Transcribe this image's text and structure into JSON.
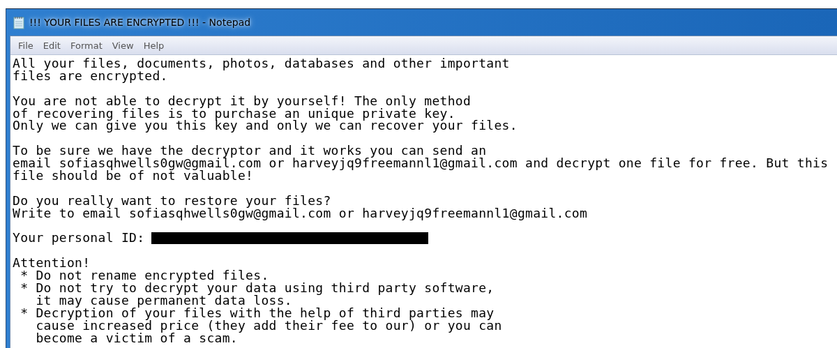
{
  "window": {
    "title": "!!! YOUR FILES ARE ENCRYPTED !!! - Notepad"
  },
  "menu": [
    "File",
    "Edit",
    "Format",
    "View",
    "Help"
  ],
  "lines": [
    {
      "kind": "text",
      "text": "All your files, documents, photos, databases and other important"
    },
    {
      "kind": "text",
      "text": "files are encrypted."
    },
    {
      "kind": "blank"
    },
    {
      "kind": "text",
      "text": "You are not able to decrypt it by yourself! The only method"
    },
    {
      "kind": "text",
      "text": "of recovering files is to purchase an unique private key."
    },
    {
      "kind": "text",
      "text": "Only we can give you this key and only we can recover your files."
    },
    {
      "kind": "blank"
    },
    {
      "kind": "text",
      "text": "To be sure we have the decryptor and it works you can send an"
    },
    {
      "kind": "text",
      "text": "email sofiasqhwells0gw@gmail.com or harveyjq9freemannl1@gmail.com and decrypt one file for free. But this"
    },
    {
      "kind": "text",
      "text": "file should be of not valuable!"
    },
    {
      "kind": "blank"
    },
    {
      "kind": "text",
      "text": "Do you really want to restore your files?"
    },
    {
      "kind": "text",
      "text": "Write to email sofiasqhwells0gw@gmail.com or harveyjq9freemannl1@gmail.com"
    },
    {
      "kind": "blank"
    },
    {
      "kind": "redacted",
      "text": "Your personal ID:"
    },
    {
      "kind": "blank"
    },
    {
      "kind": "text",
      "text": "Attention!"
    },
    {
      "kind": "text",
      "text": " * Do not rename encrypted files."
    },
    {
      "kind": "text",
      "text": " * Do not try to decrypt your data using third party software,"
    },
    {
      "kind": "text",
      "text": "   it may cause permanent data loss."
    },
    {
      "kind": "text",
      "text": " * Decryption of your files with the help of third parties may"
    },
    {
      "kind": "text",
      "text": "   cause increased price (they add their fee to our) or you can"
    },
    {
      "kind": "text",
      "text": "   become a victim of a scam."
    }
  ]
}
